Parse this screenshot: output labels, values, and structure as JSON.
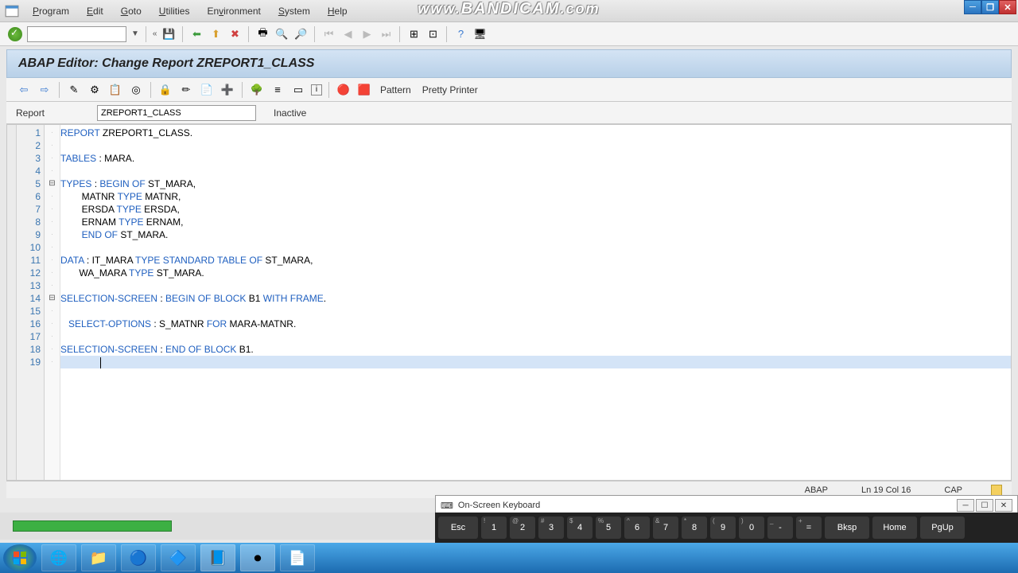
{
  "menu": {
    "program": "Program",
    "edit": "Edit",
    "goto": "Goto",
    "utilities": "Utilities",
    "environment": "Environment",
    "system": "System",
    "help": "Help"
  },
  "watermark": "www.BANDICAM.com",
  "header_title": "ABAP Editor: Change Report ZREPORT1_CLASS",
  "toolbar2": {
    "pattern": "Pattern",
    "pretty": "Pretty Printer"
  },
  "report": {
    "label": "Report",
    "value": "ZREPORT1_CLASS",
    "status": "Inactive"
  },
  "code": {
    "lines": [
      {
        "n": 1,
        "html": "<span class='kw'>REPORT</span> ZREPORT1_CLASS."
      },
      {
        "n": 2,
        "html": ""
      },
      {
        "n": 3,
        "html": "<span class='kw'>TABLES</span> : MARA."
      },
      {
        "n": 4,
        "html": ""
      },
      {
        "n": 5,
        "fold": "⊟",
        "html": "<span class='kw'>TYPES</span> : <span class='kw'>BEGIN OF</span> ST_MARA,"
      },
      {
        "n": 6,
        "html": "        MATNR <span class='kw'>TYPE</span> MATNR,"
      },
      {
        "n": 7,
        "html": "        ERSDA <span class='kw'>TYPE</span> ERSDA,"
      },
      {
        "n": 8,
        "html": "        ERNAM <span class='kw'>TYPE</span> ERNAM,"
      },
      {
        "n": 9,
        "html": "        <span class='kw'>END OF</span> ST_MARA."
      },
      {
        "n": 10,
        "html": ""
      },
      {
        "n": 11,
        "html": "<span class='kw'>DATA</span> : IT_MARA <span class='kw'>TYPE STANDARD TABLE OF</span> ST_MARA,"
      },
      {
        "n": 12,
        "html": "       WA_MARA <span class='kw'>TYPE</span> ST_MARA."
      },
      {
        "n": 13,
        "html": ""
      },
      {
        "n": 14,
        "fold": "⊟",
        "html": "<span class='kw'>SELECTION-SCREEN</span> : <span class='kw'>BEGIN OF BLOCK</span> B1 <span class='kw'>WITH FRAME</span>."
      },
      {
        "n": 15,
        "html": ""
      },
      {
        "n": 16,
        "html": "   <span class='kw'>SELECT-OPTIONS</span> : S_MATNR <span class='kw'>FOR</span> MARA-MATNR."
      },
      {
        "n": 17,
        "html": ""
      },
      {
        "n": 18,
        "html": "<span class='kw'>SELECTION-SCREEN</span> : <span class='kw'>END OF BLOCK</span> B1."
      },
      {
        "n": 19,
        "current": true,
        "html": "               <span class='cursor'></span>"
      }
    ]
  },
  "statusbar": {
    "lang": "ABAP",
    "pos": "Ln 19 Col 16",
    "cap": "CAP"
  },
  "osk_title": "On-Screen Keyboard",
  "keys": [
    "Esc",
    "1",
    "2",
    "3",
    "4",
    "5",
    "6",
    "7",
    "8",
    "9",
    "0",
    "-",
    "=",
    "Bksp",
    "Home",
    "PgUp"
  ],
  "key_sups": [
    "",
    "!",
    "@",
    "#",
    "$",
    "%",
    "^",
    "&",
    "*",
    "(",
    ")",
    "_",
    "+",
    "",
    "",
    ""
  ]
}
